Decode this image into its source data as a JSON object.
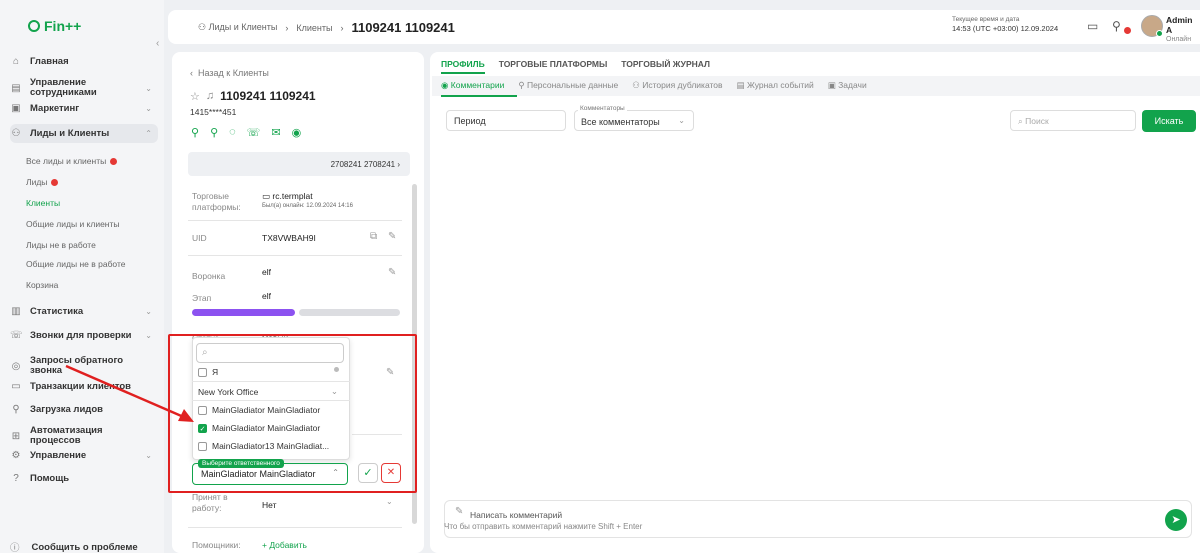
{
  "app": {
    "logo": "Fin++"
  },
  "sidebar": {
    "items": [
      {
        "label": "Главная",
        "icon": "home-icon",
        "glyph": "⌂"
      },
      {
        "label": "Управление сотрудниками",
        "icon": "staff-icon",
        "glyph": "▤",
        "chev": "⌄"
      },
      {
        "label": "Маркетинг",
        "icon": "marketing-icon",
        "glyph": "▣",
        "chev": "⌄"
      },
      {
        "label": "Лиды и Клиенты",
        "icon": "leads-icon",
        "glyph": "⚇",
        "chev": "⌃"
      },
      {
        "label": "Статистика",
        "icon": "stats-icon",
        "glyph": "▥",
        "chev": "⌄"
      },
      {
        "label": "Звонки для проверки",
        "icon": "calls-icon",
        "glyph": "☏",
        "chev": "⌄"
      },
      {
        "label": "Запросы обратного звонка",
        "icon": "callback-icon",
        "glyph": "◎"
      },
      {
        "label": "Транзакции клиентов",
        "icon": "transactions-icon",
        "glyph": "▭"
      },
      {
        "label": "Загрузка лидов",
        "icon": "upload-leads-icon",
        "glyph": "⚲"
      },
      {
        "label": "Автоматизация процессов",
        "icon": "automation-icon",
        "glyph": "⊞"
      },
      {
        "label": "Управление",
        "icon": "settings-icon",
        "glyph": "⚙",
        "chev": "⌄"
      },
      {
        "label": "Помощь",
        "icon": "help-icon",
        "glyph": "?"
      }
    ],
    "sub_items": [
      "Все лиды и клиенты",
      "Лиды",
      "Клиенты",
      "Общие лиды и клиенты",
      "Лиды не в работе",
      "Общие лиды не в работе",
      "Корзина"
    ],
    "report_problem": "Сообщить о проблеме"
  },
  "header": {
    "crumb_1": "Лиды и Клиенты",
    "crumb_2": "Клиенты",
    "current": "1109241 1109241",
    "clock_label": "Текущее время и дата",
    "clock_value": "14:53 (UTC +03:00) 12.09.2024",
    "user_name": "Admin A",
    "user_status": "Онлайн"
  },
  "client": {
    "back": "Назад к Клиенты",
    "name": "1109241 1109241",
    "phone": "1415****451",
    "linked": "2708241 2708241",
    "platform_label": "Торговые платформы:",
    "platform_value": "rc.termplat",
    "platform_seen": "Был(а) онлайн: 12.09.2024  14:16",
    "uid_label": "UID",
    "uid_value": "TX8VWBAH9I",
    "funnel_label": "Воронка",
    "funnel_value": "elf",
    "stage_label": "Этап",
    "stage_value": "elf",
    "status_label": "Статус",
    "status_value": "Новый",
    "taken_label": "Принят в работу:",
    "taken_value": "Нет",
    "helpers_label": "Помощники:",
    "add_label": "+ Добавить"
  },
  "dropdown": {
    "search_icon": "⌕",
    "opt_me": "Я",
    "group": "New York Office",
    "options": [
      {
        "label": "MainGladiator MainGladiator",
        "checked": false
      },
      {
        "label": "MainGladiator MainGladiator",
        "checked": true
      },
      {
        "label": "MainGladiator13 MainGladiat...",
        "checked": false
      }
    ],
    "resp_label": "Выберите ответственного",
    "resp_value": "MainGladiator MainGladiator"
  },
  "main": {
    "tabs1": [
      "ПРОФИЛЬ",
      "ТОРГОВЫЕ ПЛАТФОРМЫ",
      "ТОРГОВЫЙ ЖУРНАЛ"
    ],
    "tabs2": [
      "Комментарии",
      "Персональные данные",
      "История дубликатов",
      "Журнал событий",
      "Задачи"
    ],
    "period": "Период",
    "commentators_label": "Комментаторы",
    "commentators_value": "Все комментаторы",
    "search_placeholder": "Поиск",
    "search_button": "Искать",
    "composer_placeholder": "Написать комментарий",
    "composer_hint": "Что бы отправить комментарий нажмите Shift + Enter"
  },
  "colors": {
    "accent": "#12a34c",
    "progress": "#8c52f0",
    "alert": "#e02020"
  }
}
